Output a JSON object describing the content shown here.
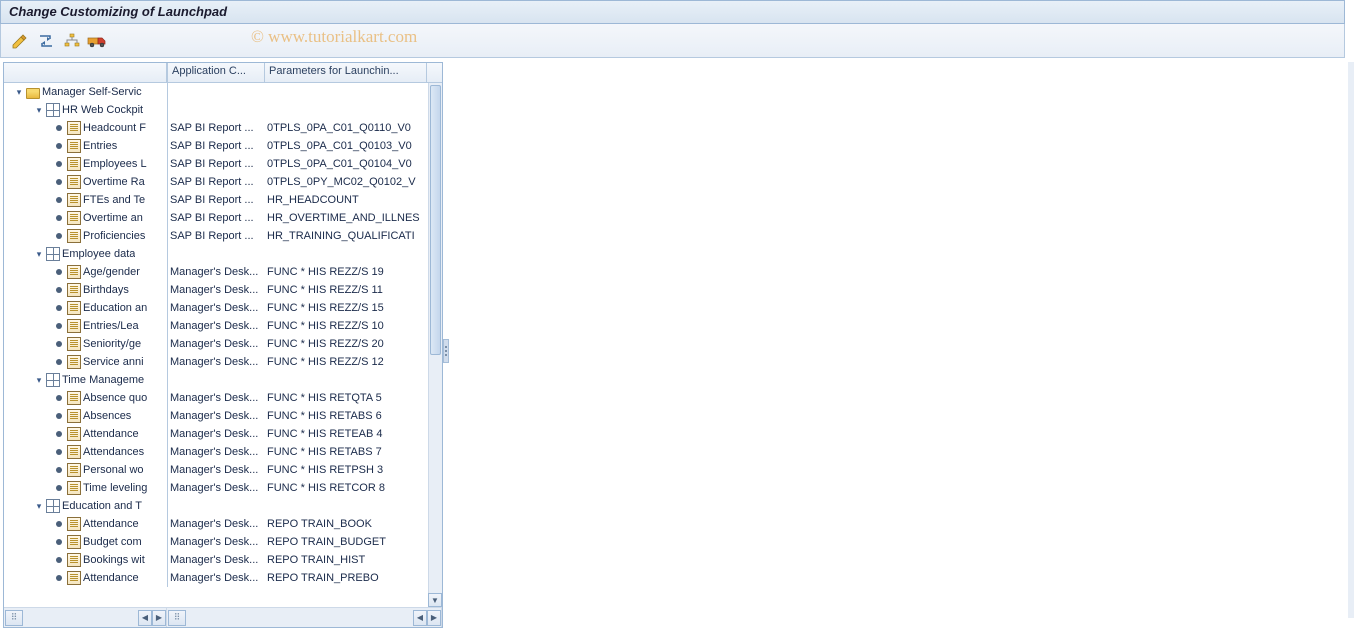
{
  "title": "Change Customizing of Launchpad",
  "watermark": "© www.tutorialkart.com",
  "toolbar": {
    "icons": [
      "pencil-icon",
      "toggle-icon",
      "hierarchy-icon",
      "transport-icon"
    ]
  },
  "columns": {
    "col1": "",
    "col2": "Application C...",
    "col3": "Parameters for Launchin..."
  },
  "tree": [
    {
      "level": 0,
      "type": "folder",
      "toggle": "▾",
      "name": "Manager Self-Servic"
    },
    {
      "level": 1,
      "type": "grid",
      "toggle": "▾",
      "name": "HR Web Cockpit"
    },
    {
      "level": 2,
      "type": "doc",
      "toggle": "•",
      "name": "Headcount F",
      "col2": "SAP BI Report ...",
      "col3": "0TPLS_0PA_C01_Q0110_V0"
    },
    {
      "level": 2,
      "type": "doc",
      "toggle": "•",
      "name": "Entries",
      "col2": "SAP BI Report ...",
      "col3": "0TPLS_0PA_C01_Q0103_V0"
    },
    {
      "level": 2,
      "type": "doc",
      "toggle": "•",
      "name": "Employees L",
      "col2": "SAP BI Report ...",
      "col3": "0TPLS_0PA_C01_Q0104_V0"
    },
    {
      "level": 2,
      "type": "doc",
      "toggle": "•",
      "name": "Overtime Ra",
      "col2": "SAP BI Report ...",
      "col3": "0TPLS_0PY_MC02_Q0102_V"
    },
    {
      "level": 2,
      "type": "doc",
      "toggle": "•",
      "name": "FTEs and Te",
      "col2": "SAP BI Report ...",
      "col3": "HR_HEADCOUNT"
    },
    {
      "level": 2,
      "type": "doc",
      "toggle": "•",
      "name": "Overtime an",
      "col2": "SAP BI Report ...",
      "col3": "HR_OVERTIME_AND_ILLNES"
    },
    {
      "level": 2,
      "type": "doc",
      "toggle": "•",
      "name": "Proficiencies",
      "col2": "SAP BI Report ...",
      "col3": "HR_TRAINING_QUALIFICATI"
    },
    {
      "level": 1,
      "type": "grid",
      "toggle": "▾",
      "name": "Employee data"
    },
    {
      "level": 2,
      "type": "doc",
      "toggle": "•",
      "name": "Age/gender",
      "col2": "Manager's Desk...",
      "col3": "FUNC * HIS REZZ/S 19"
    },
    {
      "level": 2,
      "type": "doc",
      "toggle": "•",
      "name": "Birthdays",
      "col2": "Manager's Desk...",
      "col3": "FUNC * HIS REZZ/S 11"
    },
    {
      "level": 2,
      "type": "doc",
      "toggle": "•",
      "name": "Education an",
      "col2": "Manager's Desk...",
      "col3": "FUNC * HIS REZZ/S 15"
    },
    {
      "level": 2,
      "type": "doc",
      "toggle": "•",
      "name": "Entries/Lea",
      "col2": "Manager's Desk...",
      "col3": "FUNC * HIS REZZ/S 10"
    },
    {
      "level": 2,
      "type": "doc",
      "toggle": "•",
      "name": "Seniority/ge",
      "col2": "Manager's Desk...",
      "col3": "FUNC * HIS REZZ/S 20"
    },
    {
      "level": 2,
      "type": "doc",
      "toggle": "•",
      "name": "Service anni",
      "col2": "Manager's Desk...",
      "col3": "FUNC * HIS REZZ/S 12"
    },
    {
      "level": 1,
      "type": "grid",
      "toggle": "▾",
      "name": "Time Manageme"
    },
    {
      "level": 2,
      "type": "doc",
      "toggle": "•",
      "name": "Absence quo",
      "col2": "Manager's Desk...",
      "col3": "FUNC * HIS RETQTA  5"
    },
    {
      "level": 2,
      "type": "doc",
      "toggle": "•",
      "name": "Absences",
      "col2": "Manager's Desk...",
      "col3": "FUNC * HIS RETABS  6"
    },
    {
      "level": 2,
      "type": "doc",
      "toggle": "•",
      "name": "Attendance",
      "col2": "Manager's Desk...",
      "col3": "FUNC * HIS RETEAB  4"
    },
    {
      "level": 2,
      "type": "doc",
      "toggle": "•",
      "name": "Attendances",
      "col2": "Manager's Desk...",
      "col3": "FUNC * HIS RETABS  7"
    },
    {
      "level": 2,
      "type": "doc",
      "toggle": "•",
      "name": "Personal wo",
      "col2": "Manager's Desk...",
      "col3": "FUNC * HIS RETPSH  3"
    },
    {
      "level": 2,
      "type": "doc",
      "toggle": "•",
      "name": "Time leveling",
      "col2": "Manager's Desk...",
      "col3": "FUNC * HIS RETCOR  8"
    },
    {
      "level": 1,
      "type": "grid",
      "toggle": "▾",
      "name": "Education and T"
    },
    {
      "level": 2,
      "type": "doc",
      "toggle": "•",
      "name": "Attendance",
      "col2": "Manager's Desk...",
      "col3": "REPO TRAIN_BOOK"
    },
    {
      "level": 2,
      "type": "doc",
      "toggle": "•",
      "name": "Budget com",
      "col2": "Manager's Desk...",
      "col3": "REPO TRAIN_BUDGET"
    },
    {
      "level": 2,
      "type": "doc",
      "toggle": "•",
      "name": "Bookings wit",
      "col2": "Manager's Desk...",
      "col3": "REPO TRAIN_HIST"
    },
    {
      "level": 2,
      "type": "doc",
      "toggle": "•",
      "name": "Attendance",
      "col2": "Manager's Desk...",
      "col3": "REPO TRAIN_PREBO"
    }
  ]
}
